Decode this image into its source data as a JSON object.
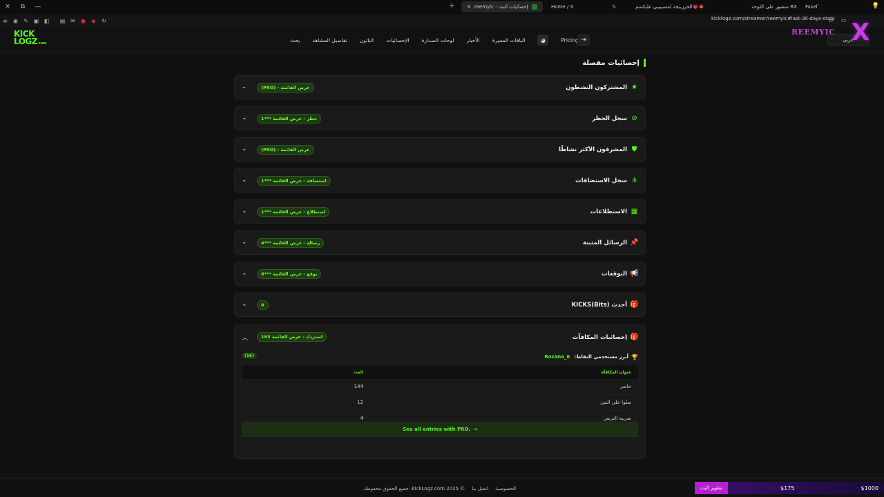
{
  "browser": {
    "tabs": [
      {
        "label": "Faselﾟ",
        "active": false
      },
      {
        "label": "منشور على اللوحة RX",
        "active": false
      },
      {
        "label": "الخرزبيجة لمسيبيبي عليكسم💗🍁",
        "active": false
      },
      {
        "label": "Home / X",
        "active": false
      },
      {
        "label": "reemyic - إحصائيات البث",
        "active": true
      }
    ],
    "url": "kicklogz.com/streamer/reemyic#last-30-days-stats"
  },
  "site": {
    "logo_top": "KICK",
    "logo_bottom": "LOGZ",
    "logo_suffix": ".com",
    "nav": [
      "بحث",
      "تفاصيل المشاهد",
      "البائون",
      "الإحصائيات",
      "لوحات الصدارة",
      "الأخبار",
      "الباقات المميزة"
    ],
    "pricing": "Pricing",
    "overlay_brand": "REEMYIC",
    "lang": "عربي"
  },
  "section": {
    "title": "إحصائيات مفصلة"
  },
  "accordions": [
    {
      "label": "المشتركون النشطون",
      "icon": "star-icon",
      "glyph": "★",
      "badge": "عرض القائمة - (PRO)"
    },
    {
      "label": "سجل الحظر",
      "icon": "ban-icon",
      "glyph": "⊘",
      "badge": "حظر - عرض القائمة ***1"
    },
    {
      "label": "المشرفون الأكثر نشاطًا",
      "icon": "shield-icon",
      "glyph": "⛊",
      "badge": "عرض القائمة - (PRO)"
    },
    {
      "label": "سجل الاستضافات",
      "icon": "share-icon",
      "glyph": "⋔",
      "badge": "استضافة - عرض القائمة ***1"
    },
    {
      "label": "الاستطلاعات",
      "icon": "poll-icon",
      "glyph": "▦",
      "badge": "استطلاع - عرض القائمة ***1"
    },
    {
      "label": "الرسائل المثبتة",
      "icon": "pin-icon",
      "glyph": "📌",
      "badge": "رسالة - عرض القائمة ***4"
    },
    {
      "label": "التوقعات",
      "icon": "megaphone-icon",
      "glyph": "📢",
      "badge": "توقع - عرض القائمة ***0"
    },
    {
      "label": "أحدث KICKS(Bits)",
      "icon": "gift-icon",
      "glyph": "🎁",
      "badge": "0"
    }
  ],
  "rewards": {
    "label": "إحصائيات المكافآت",
    "badge": "استرداد - عرض القائمة 163",
    "top_label": "أبرز مستخدمي النقاط:",
    "top_user": "Rozana_6",
    "top_count": "(16)",
    "columns": [
      "عنوان المكافأة",
      "العدد"
    ],
    "rows": [
      [
        "حاضر",
        "144"
      ],
      [
        "صلوا على النبي",
        "12"
      ],
      [
        "ضريبة التربص",
        "4"
      ]
    ],
    "see_all": "See all entries with PRO."
  },
  "footer": {
    "copyright": "© 2025 KickLogz.com. جميع الحقوق محفوظة.",
    "contact": "اتصل بنا",
    "privacy": "الخصوصية"
  },
  "ticker": {
    "pill": "تطوير البث",
    "amount1": "$175",
    "amount2": "$1000"
  },
  "colors": {
    "accent": "#53fc18",
    "background": "#111111",
    "card": "#1a1a1a",
    "overlay": "#c83ee2"
  }
}
